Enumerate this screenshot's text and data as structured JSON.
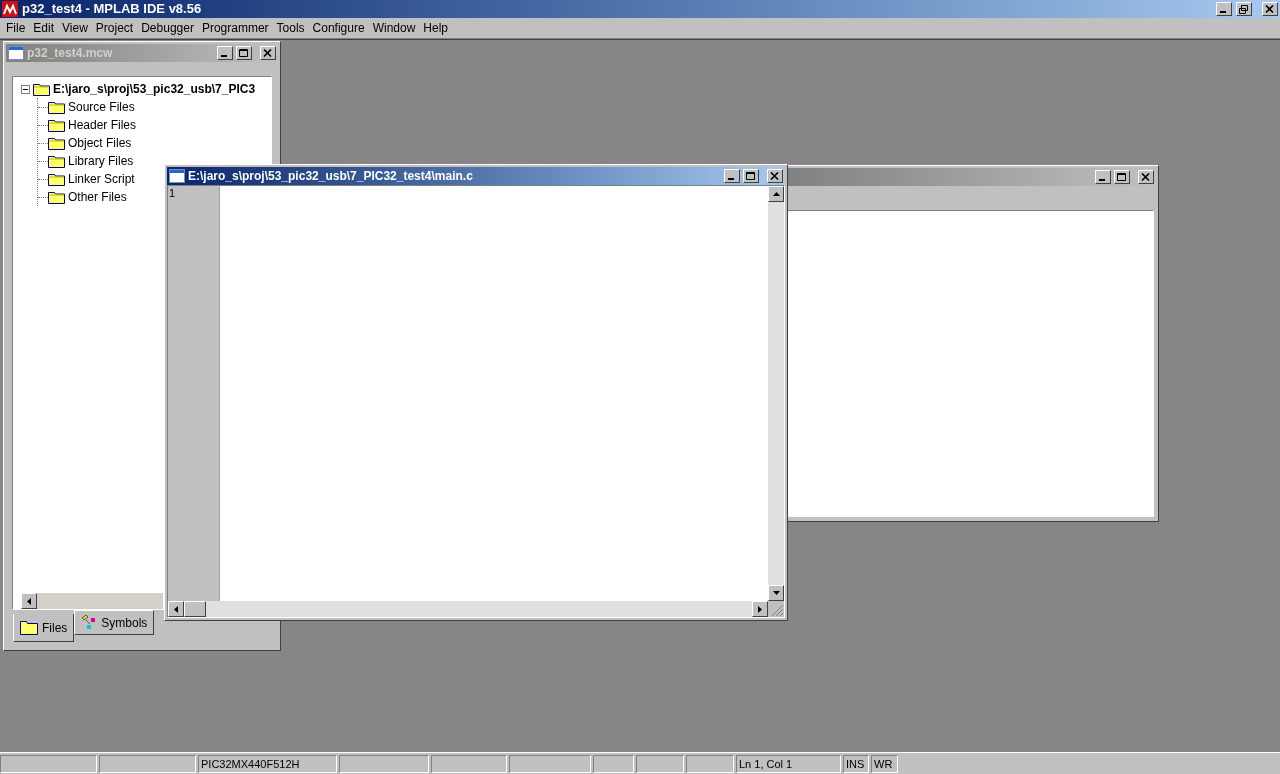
{
  "app": {
    "title": "p32_test4 - MPLAB IDE v8.56"
  },
  "menu": [
    "File",
    "Edit",
    "View",
    "Project",
    "Debugger",
    "Programmer",
    "Tools",
    "Configure",
    "Window",
    "Help"
  ],
  "project_window": {
    "title": "p32_test4.mcw",
    "active": false,
    "tree": {
      "label": "E:\\jaro_s\\proj\\53_pic32_usb\\7_PIC3",
      "expanded": true,
      "children": [
        {
          "label": "Source Files"
        },
        {
          "label": "Header Files"
        },
        {
          "label": "Object Files"
        },
        {
          "label": "Library Files"
        },
        {
          "label": "Linker Script"
        },
        {
          "label": "Other Files"
        }
      ]
    },
    "tabs": [
      {
        "label": "Files",
        "kind": "files",
        "selected": true
      },
      {
        "label": "Symbols",
        "kind": "symbols",
        "selected": false
      }
    ]
  },
  "output_window": {
    "active": false
  },
  "editor_window": {
    "title": "E:\\jaro_s\\proj\\53_pic32_usb\\7_PIC32_test4\\main.c",
    "active": true,
    "line_numbers": [
      "1"
    ]
  },
  "status_bar": {
    "panes": [
      {
        "text": "PIC32MX440F512H"
      },
      {
        "text": "Ln 1, Col 1"
      },
      {
        "text": "INS"
      },
      {
        "text": "WR"
      }
    ]
  }
}
